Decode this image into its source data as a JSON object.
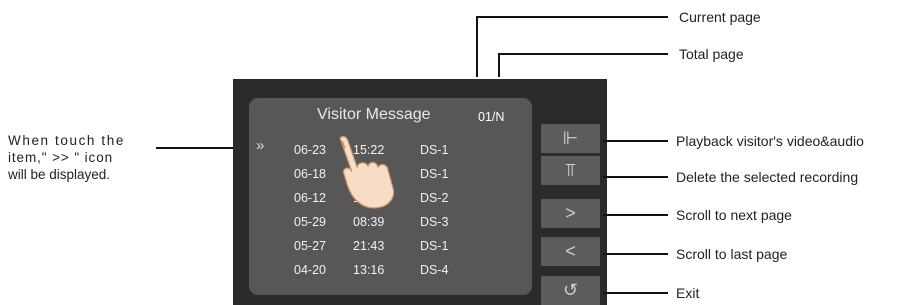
{
  "screen": {
    "title": "Visitor Message",
    "page_indicator": "01/N",
    "selected_marker": "»",
    "records": [
      {
        "date": "06-23",
        "time": "15:22",
        "station": "DS-1"
      },
      {
        "date": "06-18",
        "time": "",
        "station": "DS-1"
      },
      {
        "date": "06-12",
        "time": "1",
        "station": "DS-2"
      },
      {
        "date": "05-29",
        "time": "08:39",
        "station": "DS-3"
      },
      {
        "date": "05-27",
        "time": "21:43",
        "station": "DS-1"
      },
      {
        "date": "04-20",
        "time": "13:16",
        "station": "DS-4"
      }
    ],
    "buttons": [
      {
        "icon": "playback-icon",
        "glyph": "⊩"
      },
      {
        "icon": "delete-icon",
        "glyph": "⫪"
      },
      {
        "icon": "next-page-icon",
        "glyph": ">"
      },
      {
        "icon": "last-page-icon",
        "glyph": "<"
      },
      {
        "icon": "exit-icon",
        "glyph": "↺"
      }
    ]
  },
  "callouts": {
    "current_page": "Current page",
    "total_page": "Total page",
    "playback": "Playback visitor's video&audio",
    "delete": "Delete the selected recording",
    "next_page": "Scroll to next page",
    "last_page": "Scroll to last page",
    "exit": "Exit"
  },
  "left_note": {
    "line1": "When touch the",
    "line2": "item,\" >> \" icon",
    "line3": "will be displayed."
  }
}
